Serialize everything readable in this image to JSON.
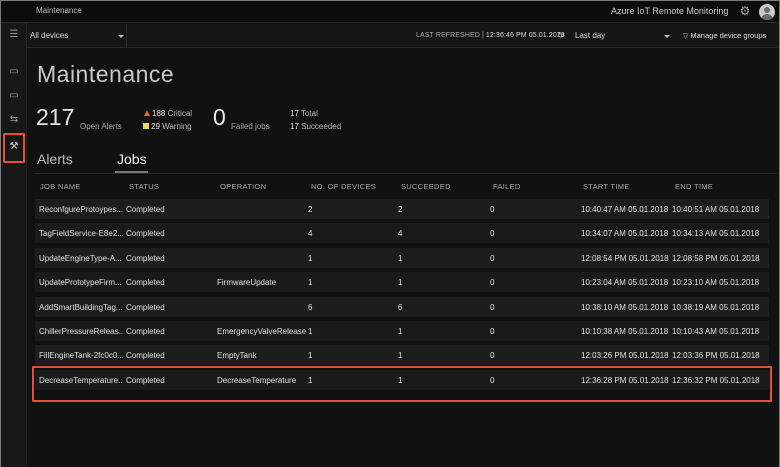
{
  "header": {
    "breadcrumb": "Maintenance",
    "product": "Azure IoT Remote Monitoring",
    "gear_glyph": "⚙"
  },
  "nav": {
    "items": [
      {
        "name": "dashboard-icon",
        "glyph": "▭"
      },
      {
        "name": "devices-icon",
        "glyph": "▭"
      },
      {
        "name": "rules-icon",
        "glyph": "⇆"
      },
      {
        "name": "maintenance-icon",
        "glyph": "⚒"
      }
    ],
    "menu_glyph": "☰"
  },
  "context": {
    "device_group": "All devices",
    "last_refreshed_label": "LAST REFRESHED |",
    "last_refreshed_value": "12:36:46 PM 05.01.2018",
    "refresh_glyph": "↻",
    "time_range": "Last day",
    "manage_groups": "Manage device groups",
    "funnel_glyph": "▽"
  },
  "page": {
    "title": "Maintenance"
  },
  "kpis": {
    "open_alerts_value": "217",
    "open_alerts_label": "Open Alerts",
    "critical_count": "188",
    "critical_label": "Critical",
    "warning_count": "29",
    "warning_label": "Warning",
    "failed_jobs_value": "0",
    "failed_jobs_label": "Failed jobs",
    "total_count": "17",
    "total_label": "Total",
    "succeeded_count": "17",
    "succeeded_label": "Succeeded"
  },
  "tabs": {
    "alerts": "Alerts",
    "jobs": "Jobs"
  },
  "colors": {
    "critical": "#e8622c",
    "warning": "#f2d55c",
    "highlight": "#e0503a"
  },
  "table": {
    "headers": [
      "JOB NAME",
      "STATUS",
      "OPERATION",
      "NO. OF DEVICES",
      "SUCCEEDED",
      "FAILED",
      "START TIME",
      "END TIME"
    ],
    "rows": [
      [
        "ReconfgureProtoypes...",
        "Completed",
        "",
        "2",
        "2",
        "0",
        "10:40:47 AM 05.01.2018",
        "10:40:51 AM 05.01.2018"
      ],
      [
        "TagFieldService-E8e2...",
        "Completed",
        "",
        "4",
        "4",
        "0",
        "10:34:07 AM 05.01.2018",
        "10:34:13 AM 05.01.2018"
      ],
      [
        "UpdateEngineType-A...",
        "Completed",
        "",
        "1",
        "1",
        "0",
        "12:08:54 PM 05.01.2018",
        "12:08:58 PM 05.01.2018"
      ],
      [
        "UpdatePrototypeFirm...",
        "Completed",
        "FirmwareUpdate",
        "1",
        "1",
        "0",
        "10:23:04 AM 05.01.2018",
        "10:23:10 AM 05.01.2018"
      ],
      [
        "AddSmartBuildingTag...",
        "Completed",
        "",
        "6",
        "6",
        "0",
        "10:38:10 AM 05.01.2018",
        "10:38:19 AM 05.01.2018"
      ],
      [
        "ChillerPressureReleas...",
        "Completed",
        "EmergencyValveRelease",
        "1",
        "1",
        "0",
        "10:10:38 AM 05.01.2018",
        "10:10:43 AM 05.01.2018"
      ],
      [
        "FillEngineTank-2fc0c0...",
        "Completed",
        "EmptyTank",
        "1",
        "1",
        "0",
        "12:03:26 PM 05.01.2018",
        "12:03:36 PM 05.01.2018"
      ],
      [
        "DecreaseTemperature...",
        "Completed",
        "DecreaseTemperature",
        "1",
        "1",
        "0",
        "12:36:28 PM 05.01.2018",
        "12:36:32 PM 05.01.2018"
      ]
    ]
  }
}
